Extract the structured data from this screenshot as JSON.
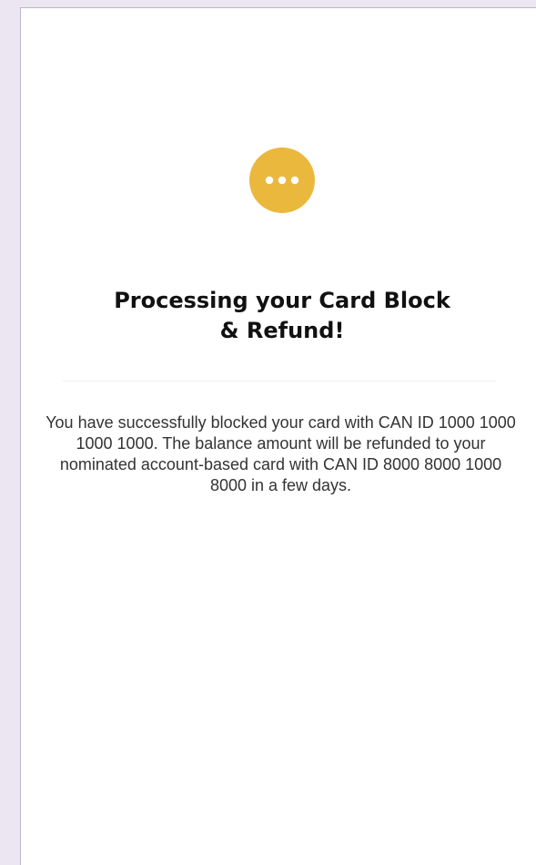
{
  "status": {
    "icon": "more-horizontal-icon",
    "icon_color": "#ebb83e",
    "title_line1": "Processing your Card Block",
    "title_line2": "& Refund!"
  },
  "message": {
    "text": "You have successfully blocked your card with CAN ID 1000 1000 1000 1000.  The balance amount will be refunded to your nominated account-based card with CAN ID 8000 8000 1000 8000  in a few days."
  }
}
